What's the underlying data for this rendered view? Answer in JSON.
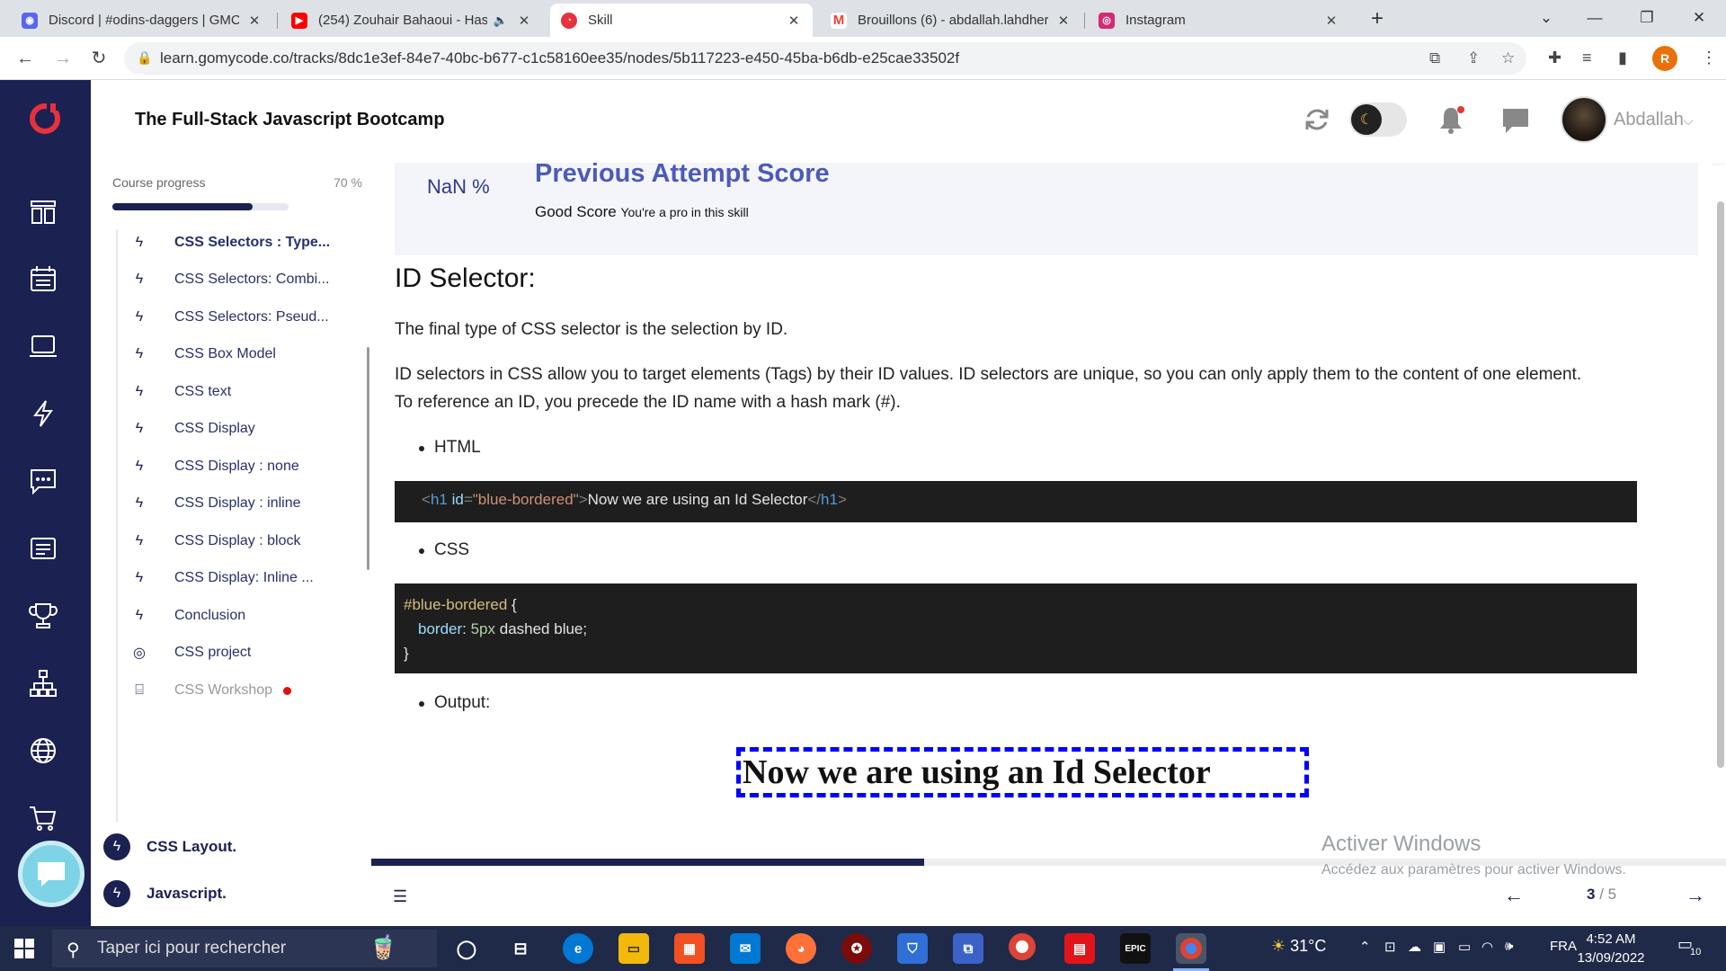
{
  "browser": {
    "tabs": [
      {
        "title": "Discord | #odins-daggers | GMC",
        "icon": "discord-icon",
        "color": "#5865f2"
      },
      {
        "title": "(254) Zouhair Bahaoui - Hast",
        "icon": "youtube-icon",
        "color": "#ff0000"
      },
      {
        "title": "Skill",
        "icon": "gomycode-icon",
        "color": "#e8313e"
      },
      {
        "title": "Brouillons (6) - abdallah.lahdheri",
        "icon": "gmail-icon",
        "color": "#ea4335"
      },
      {
        "title": "Instagram",
        "icon": "instagram-icon",
        "color": "#d62976"
      }
    ],
    "url": "learn.gomycode.co/tracks/8dc1e3ef-84e7-40bc-b677-c1c58160ee35/nodes/5b117223-e450-45ba-b6db-e25cae33502f",
    "profile_initial": "R"
  },
  "header": {
    "course_title": "The Full-Stack Javascript Bootcamp",
    "username": "Abdallah",
    "brand_color": "#1b2151",
    "accent_color": "#e8313e"
  },
  "sidebar": {
    "progress_label": "Course progress",
    "progress_value": "70 %",
    "progress_fraction": 0.7,
    "lessons": [
      {
        "label": "CSS Selectors : Type...",
        "icon": "bolt-icon",
        "state": "current"
      },
      {
        "label": "CSS Selectors: Combi...",
        "icon": "bolt-icon",
        "state": ""
      },
      {
        "label": "CSS Selectors: Pseud...",
        "icon": "bolt-icon",
        "state": ""
      },
      {
        "label": "CSS Box Model",
        "icon": "bolt-icon",
        "state": ""
      },
      {
        "label": "CSS text",
        "icon": "bolt-icon",
        "state": ""
      },
      {
        "label": "CSS Display",
        "icon": "bolt-icon",
        "state": ""
      },
      {
        "label": "CSS Display : none",
        "icon": "bolt-icon",
        "state": ""
      },
      {
        "label": "CSS Display : inline",
        "icon": "bolt-icon",
        "state": ""
      },
      {
        "label": "CSS Display : block",
        "icon": "bolt-icon",
        "state": ""
      },
      {
        "label": "CSS Display: Inline ...",
        "icon": "bolt-icon",
        "state": ""
      },
      {
        "label": "Conclusion",
        "icon": "bolt-icon",
        "state": ""
      },
      {
        "label": "CSS project",
        "icon": "target-icon",
        "state": ""
      },
      {
        "label": "CSS Workshop",
        "icon": "workshop-icon",
        "state": "disabled"
      }
    ],
    "sections": [
      {
        "label": "CSS Layout."
      },
      {
        "label": "Javascript."
      }
    ]
  },
  "content": {
    "score_percent": "NaN %",
    "score_title": "Previous Attempt Score",
    "score_good": "Good Score",
    "score_note": "You're a pro in this skill",
    "heading": "ID Selector:",
    "para1": "The final type of CSS selector is the selection by ID.",
    "para2_line1": "ID selectors in CSS allow you to target elements (Tags) by their ID values. ID selectors are unique, so you can only apply them to the content of one element.",
    "para2_line2": "To reference an ID, you precede the ID name with a hash mark (#).",
    "bullet_html": "HTML",
    "bullet_css": "CSS",
    "bullet_output": "Output:",
    "code_html": {
      "open_lt": "<",
      "tag": "h1",
      "attr": "id",
      "eq": "=",
      "value": "\"blue-bordered\"",
      "gt": ">",
      "text": "Now we are using an Id Selector",
      "close_lt": "</",
      "close_tag": "h1",
      "close_gt": ">"
    },
    "code_css": {
      "selector": "#blue-bordered",
      "open_brace": " {",
      "property": "border",
      "colon": ": ",
      "num": "5px",
      "rest": " dashed blue;",
      "close_brace": "}"
    },
    "output_text": "Now we are using an Id Selector"
  },
  "footer": {
    "page_current": "3",
    "page_total": " / 5",
    "progress_fraction": 0.408
  },
  "watermark": {
    "line1": "Activer Windows",
    "line2": "Accédez aux paramètres pour activer Windows."
  },
  "taskbar": {
    "search_placeholder": "Taper ici pour rechercher",
    "temperature": "31°C",
    "language": "FRA",
    "time": "4:52 AM",
    "date": "13/09/2022",
    "notifications": "10"
  }
}
